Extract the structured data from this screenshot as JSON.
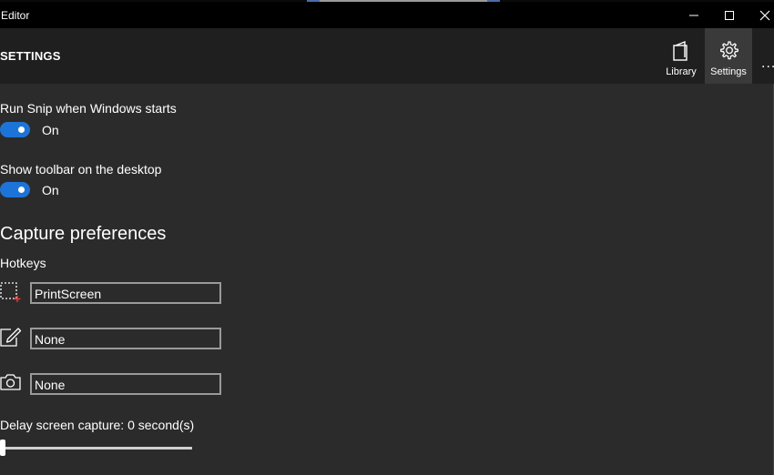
{
  "window": {
    "title": "Editor"
  },
  "header": {
    "page_title": "SETTINGS",
    "library_label": "Library",
    "settings_label": "Settings",
    "more_label": "..."
  },
  "settings": {
    "run_on_start": {
      "label": "Run Snip when Windows starts",
      "state": "On"
    },
    "show_toolbar": {
      "label": "Show toolbar on the desktop",
      "state": "On"
    },
    "capture_title": "Capture preferences",
    "hotkeys_label": "Hotkeys",
    "hotkeys": [
      {
        "icon": "region-capture-icon",
        "value": "PrintScreen"
      },
      {
        "icon": "whiteboard-pen-icon",
        "value": "None"
      },
      {
        "icon": "camera-icon",
        "value": "None"
      }
    ],
    "delay_label": "Delay screen capture: 0 second(s)",
    "delay_seconds": 0
  },
  "colors": {
    "toggle_on": "#1d74d8",
    "background": "#2b2b2b",
    "header_bg": "#1f1f1f",
    "titlebar_bg": "#000000"
  }
}
